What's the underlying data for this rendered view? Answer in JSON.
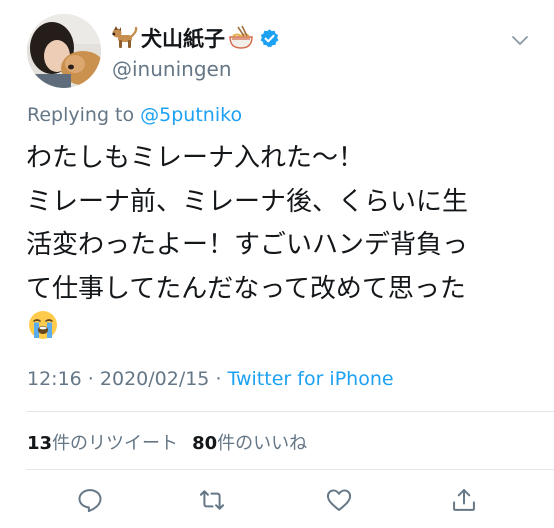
{
  "author": {
    "display_name": "犬山紙子",
    "handle": "@inuningen",
    "prefix_emoji": "dog-emoji",
    "suffix_emoji": "ramen-bowl-emoji",
    "verified": true
  },
  "reply": {
    "prefix": "Replying to ",
    "mention": "@5putniko"
  },
  "tweet": {
    "lines": [
      "わたしもミレーナ入れた〜！",
      "ミレーナ前、ミレーナ後、くらいに生",
      "活変わったよー！すごいハンデ背負っ",
      "て仕事してたんだなって改めて思った"
    ],
    "trailing_emoji": "loudly-crying-face-emoji"
  },
  "meta": {
    "time": "12:16",
    "separator": " · ",
    "date": "2020/02/15",
    "source": "Twitter for iPhone"
  },
  "stats": {
    "retweets_count": "13",
    "retweets_label": "件のリツイート",
    "likes_count": "80",
    "likes_label": "件のいいね"
  },
  "icons": {
    "menu": "chevron-down-icon",
    "reply": "reply-icon",
    "retweet": "retweet-icon",
    "like": "heart-icon",
    "share": "share-icon"
  },
  "colors": {
    "link": "#1da1f2",
    "secondary_text": "#657786",
    "primary_text": "#14171a",
    "icon": "#657786",
    "divider": "#e1e8ed"
  }
}
